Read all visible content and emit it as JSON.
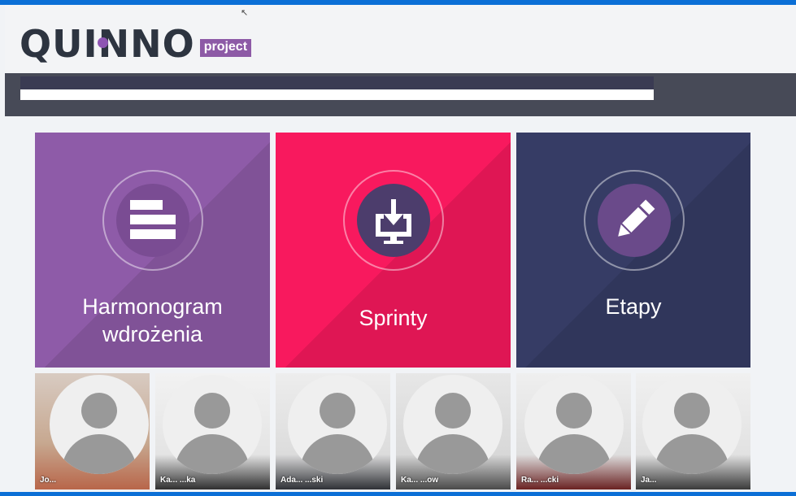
{
  "topbar": {
    "color": "#0b6fd6"
  },
  "logo": {
    "wordmark": "QUINNO",
    "badge": "project"
  },
  "tiles": [
    {
      "id": "harmonogram",
      "label_line1": "Harmonogram",
      "label_line2": "wdrożenia",
      "icon": "list-icon",
      "color": "#8e5ba8"
    },
    {
      "id": "sprinty",
      "label_line1": "Sprinty",
      "label_line2": "",
      "icon": "download-monitor-icon",
      "color": "#f8195e"
    },
    {
      "id": "etapy",
      "label_line1": "Etapy",
      "label_line2": "",
      "icon": "pencil-icon",
      "color": "#363c65"
    }
  ],
  "people": [
    {
      "name": "Jo..."
    },
    {
      "name": "Ka... ...ka"
    },
    {
      "name": "Ada... ...ski"
    },
    {
      "name": "Ka... ...ow"
    },
    {
      "name": "Ra... ...cki"
    },
    {
      "name": "Ja..."
    }
  ]
}
